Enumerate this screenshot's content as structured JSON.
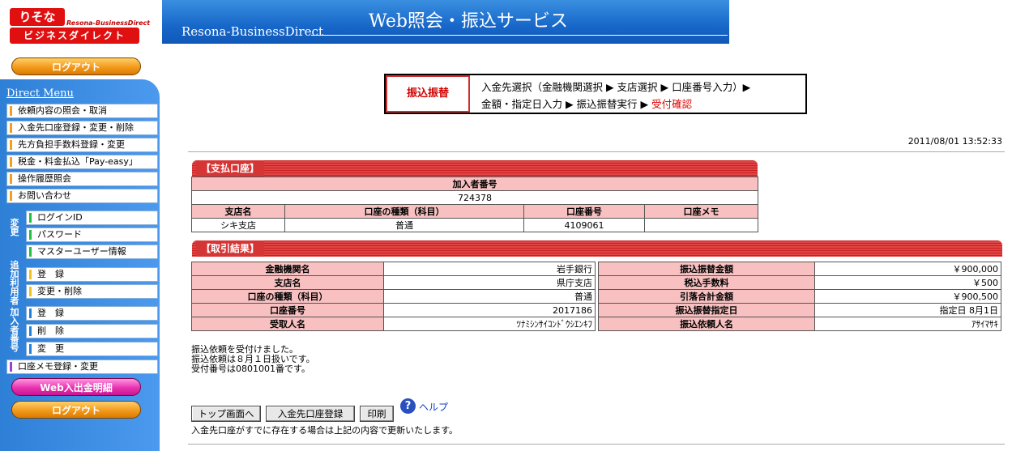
{
  "logo": {
    "brand": "りそな",
    "sub": "Resona-BusinessDirect",
    "product": "ビジネスダイレクト"
  },
  "header": {
    "title": "Web照会・振込サービス",
    "subtitle": "Resona-BusinessDirect"
  },
  "sidebar": {
    "logout_top": "ログアウト",
    "menu_title": "Direct Menu",
    "items": [
      {
        "label": "依頼内容の照会・取消",
        "bar": "#f0a020"
      },
      {
        "label": "入金先口座登録・変更・削除",
        "bar": "#f0a020"
      },
      {
        "label": "先方負担手数料登録・変更",
        "bar": "#f0a020"
      },
      {
        "label": "税金・料金払込「Pay-easy」",
        "bar": "#f0a020"
      },
      {
        "label": "操作履歴照会",
        "bar": "#f0a020"
      },
      {
        "label": "お問い合わせ",
        "bar": "#f0a020"
      }
    ],
    "change_label": "変更",
    "change_items": [
      "ログインID",
      "パスワード",
      "マスターユーザー情報"
    ],
    "add_user_label": "追加利用者",
    "add_user_items": [
      "登　録",
      "変更・削除"
    ],
    "member_label": "加入者番号",
    "member_items": [
      "登　録",
      "削　除",
      "変　更"
    ],
    "memo_item": "口座メモ登録・変更",
    "web_button": "Web入出金明細",
    "logout_bottom": "ログアウト",
    "bar_green": "#20c040",
    "bar_yellow": "#f0c020",
    "bar_blue": "#2080e0",
    "bar_purple": "#a040d0"
  },
  "step": {
    "badge": "振込振替",
    "line1": "入金先選択（金融機関選択 ▶ 支店選択 ▶ 口座番号入力）▶",
    "line2_prefix": "金額・指定日入力 ▶ 振込振替実行 ▶ ",
    "line2_current": "受付確認"
  },
  "datetime": "2011/08/01 13:52:33",
  "payment": {
    "section": "【支払口座】",
    "member_header": "加入者番号",
    "member_number": "724378",
    "headers": [
      "支店名",
      "口座の種類（科目）",
      "口座番号",
      "口座メモ"
    ],
    "values": [
      "シキ支店",
      "普通",
      "4109061",
      ""
    ]
  },
  "result": {
    "section": "【取引結果】",
    "left": [
      {
        "label": "金融機関名",
        "value": "岩手銀行"
      },
      {
        "label": "支店名",
        "value": "県庁支店"
      },
      {
        "label": "口座の種類（科目）",
        "value": "普通"
      },
      {
        "label": "口座番号",
        "value": "2017186"
      },
      {
        "label": "受取人名",
        "value": "ﾂﾅﾐｼﾝｻｲｺﾝﾄﾞｳｼｴﾝｷﾌ"
      }
    ],
    "right": [
      {
        "label": "振込振替金額",
        "value": "￥900,000"
      },
      {
        "label": "税込手数料",
        "value": "￥500"
      },
      {
        "label": "引落合計金額",
        "value": "￥900,500"
      },
      {
        "label": "振込振替指定日",
        "value": "指定日 8月1日"
      },
      {
        "label": "振込依頼人名",
        "value": "ｱｻｲﾏｻｷ"
      }
    ]
  },
  "message": [
    "振込依頼を受付けました。",
    "振込依頼は８月１日扱いです。",
    "受付番号は0801001番です。"
  ],
  "buttons": {
    "top": "トップ画面へ",
    "register": "入金先口座登録",
    "print": "印刷",
    "help": "ヘルプ"
  },
  "note": "入金先口座がすでに存在する場合は上記の内容で更新いたします。"
}
